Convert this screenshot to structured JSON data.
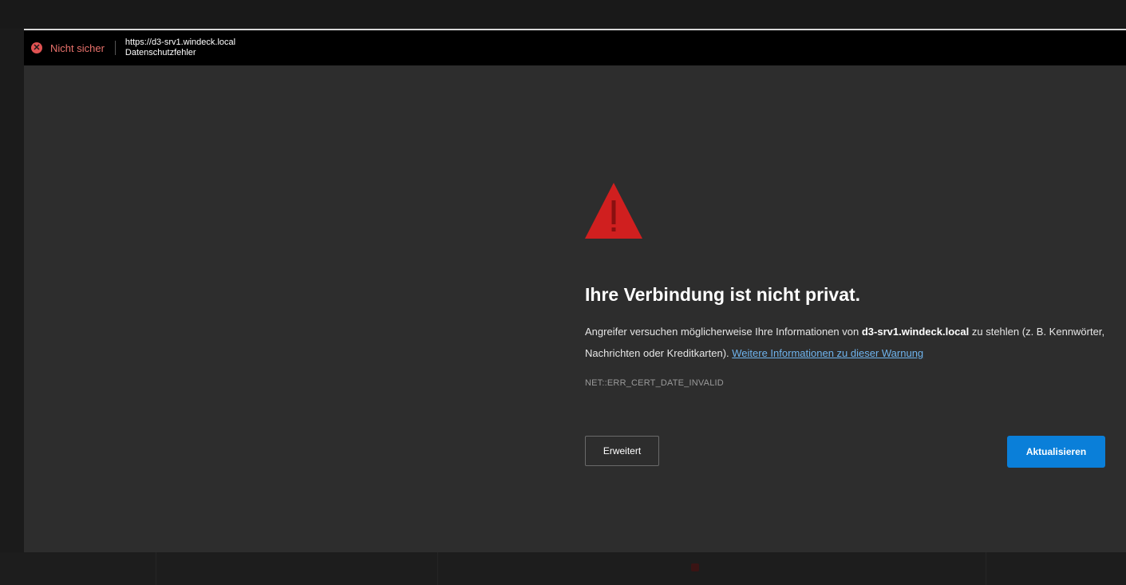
{
  "titlebar": {
    "security_label": "Nicht sicher",
    "url": "https://d3-srv1.windeck.local",
    "page_title": "Datenschutzfehler"
  },
  "warning": {
    "heading": "Ihre Verbindung ist nicht privat.",
    "desc_part1": "Angreifer versuchen möglicherweise Ihre Informationen von ",
    "desc_host": "d3-srv1.windeck.local",
    "desc_part2": " zu stehlen (z. B. Kennwörter, Nachrichten oder Kreditkarten). ",
    "more_info_link": "Weitere Informationen zu dieser Warnung",
    "error_code": "NET::ERR_CERT_DATE_INVALID"
  },
  "buttons": {
    "advanced_label": "Erweitert",
    "refresh_label": "Aktualisieren"
  },
  "icons": {
    "security": "x-circle-icon",
    "warning": "warning-triangle-icon"
  },
  "colors": {
    "warning_red": "#d01f1f",
    "link_blue": "#6fb4ee",
    "primary_button": "#0a7fd9",
    "insecure_red": "#e05252"
  }
}
